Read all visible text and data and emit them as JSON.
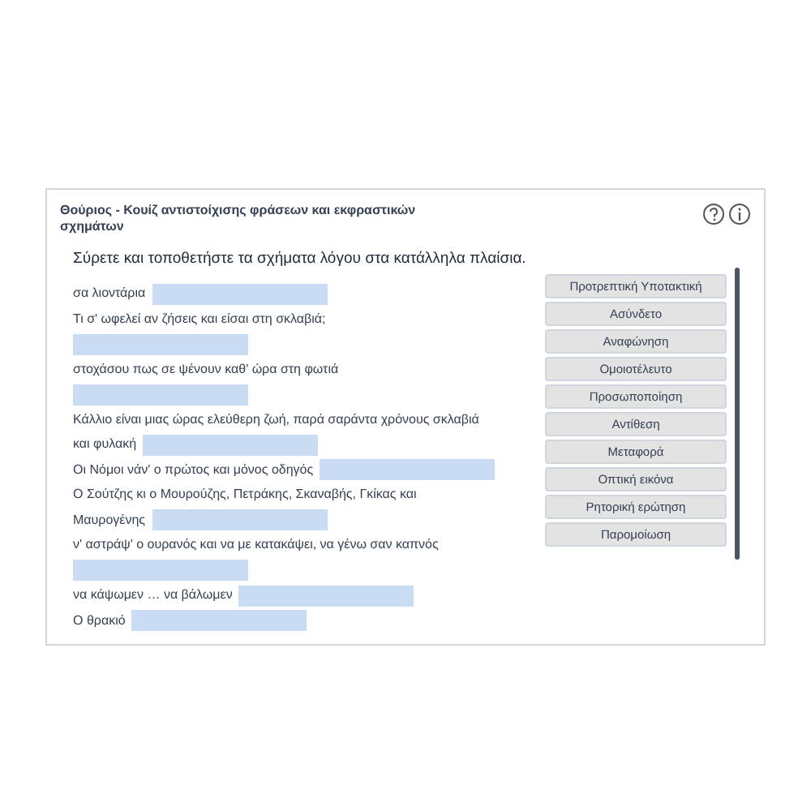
{
  "card": {
    "title": "Θούριος - Κουίζ αντιστοίχισης φράσεων και εκφραστικών σχημάτων"
  },
  "instruction": "Σύρετε και τοποθετήστε τα σχήματα λόγου στα κατάλληλα πλαίσια.",
  "lines": [
    [
      {
        "kind": "text",
        "text": "σα λιοντάρια"
      },
      {
        "kind": "blank"
      }
    ],
    [
      {
        "kind": "text",
        "text": "Τι σ' ωφελεί αν ζήσεις και είσαι στη σκλαβιά;"
      }
    ],
    [
      {
        "kind": "blank"
      }
    ],
    [
      {
        "kind": "text",
        "text": "στοχάσου πως σε ψένουν καθ' ώρα στη φωτιά"
      }
    ],
    [
      {
        "kind": "blank"
      }
    ],
    [
      {
        "kind": "text",
        "text": "Κάλλιο είναι μιας ώρας ελεύθερη ζωή, παρά σαράντα χρόνους σκλαβιά"
      }
    ],
    [
      {
        "kind": "text",
        "text": "και φυλακή"
      },
      {
        "kind": "blank"
      }
    ],
    [
      {
        "kind": "text",
        "text": "Οι Νόμοι νάν' ο πρώτος και μόνος οδηγός"
      },
      {
        "kind": "blank"
      }
    ],
    [
      {
        "kind": "text",
        "text": "Ο Σούτζης κι ο Μουρούζης, Πετράκης, Σκαναβής, Γκίκας και"
      }
    ],
    [
      {
        "kind": "text",
        "text": "Μαυρογένης"
      },
      {
        "kind": "blank"
      }
    ],
    [
      {
        "kind": "text",
        "text": "ν' αστράψ' ο ουρανός και να με κατακάψει, να γένω σαν καπνός"
      }
    ],
    [
      {
        "kind": "blank"
      }
    ],
    [
      {
        "kind": "text",
        "text": "να κάψωμεν … να βάλωμεν"
      },
      {
        "kind": "blank"
      }
    ],
    [
      {
        "kind": "text",
        "text": "Ο θρακιό"
      },
      {
        "kind": "blank"
      }
    ]
  ],
  "options": [
    "Προτρεπτική Υποτακτική",
    "Ασύνδετο",
    "Αναφώνηση",
    "Ομοιοτέλευτο",
    "Προσωποποίηση",
    "Αντίθεση",
    "Μεταφορά",
    "Οπτική εικόνα",
    "Ρητορική ερώτηση",
    "Παρομοίωση"
  ]
}
